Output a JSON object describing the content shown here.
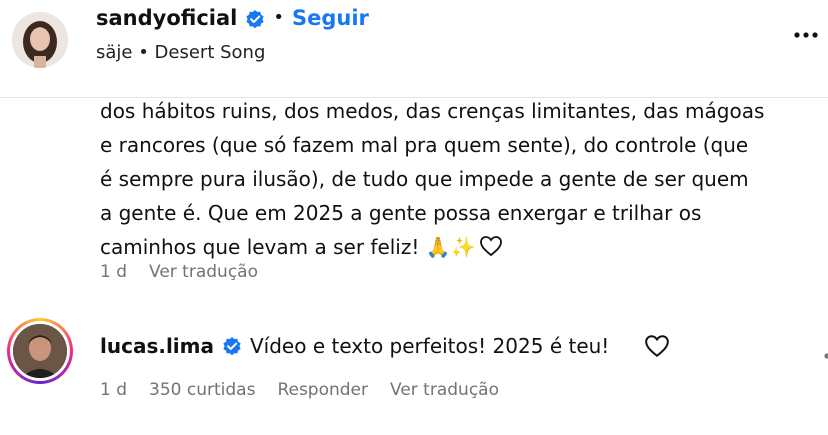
{
  "post": {
    "username": "sandyoficial",
    "separator": "•",
    "follow_label": "Seguir",
    "audio": "säje • Desert Song"
  },
  "caption": {
    "lines": [
      "dos hábitos ruins, dos medos, das crenças limitantes, das mágoas",
      "e rancores (que só fazem mal pra quem sente), do controle (que",
      "é sempre pura ilusão), de tudo que impede a gente de ser quem",
      "a gente é. Que em 2025 a gente possa enxergar e trilhar os",
      "caminhos que levam a ser feliz! 🙏✨"
    ],
    "time": "1 d",
    "translate": "Ver tradução"
  },
  "comment": {
    "username": "lucas.lima",
    "text": "Vídeo e texto perfeitos! 2025 é teu!",
    "time": "1 d",
    "likes": "350 curtidas",
    "reply": "Responder",
    "translate": "Ver tradução"
  },
  "colors": {
    "accent": "#1877f2",
    "verified": "#1877f2",
    "muted": "#737373"
  },
  "icons": [
    "verified-badge-icon",
    "more-options-icon",
    "heart-outline-icon"
  ]
}
